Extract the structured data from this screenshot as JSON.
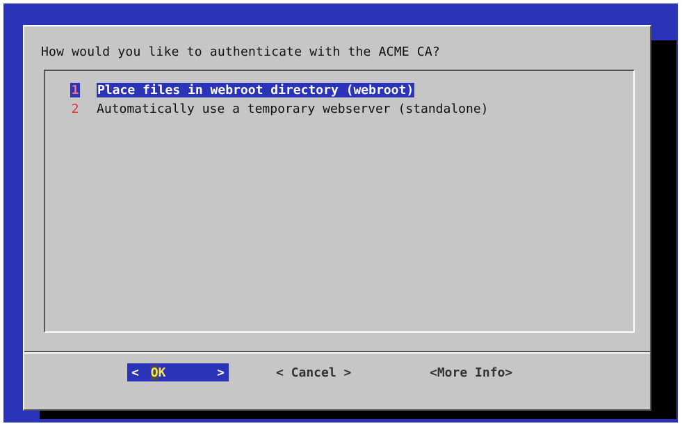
{
  "dialog": {
    "prompt": "How would you like to authenticate with the ACME CA?",
    "items": [
      {
        "number": "1",
        "label": "Place files in webroot directory (webroot)",
        "selected": true
      },
      {
        "number": "2",
        "label": "Automatically use a temporary webserver (standalone)",
        "selected": false
      }
    ]
  },
  "buttons": {
    "ok": {
      "left": "<",
      "hot": "O",
      "rest": "K",
      "right": ">"
    },
    "cancel": "< Cancel >",
    "more_info": "<More Info>"
  },
  "colors": {
    "terminal_bg": "#2b34b8",
    "dialog_bg": "#c6c6c6",
    "highlight": "#2b34b8",
    "item_number": "#e0313a",
    "hotkey": "#f5e35a"
  }
}
